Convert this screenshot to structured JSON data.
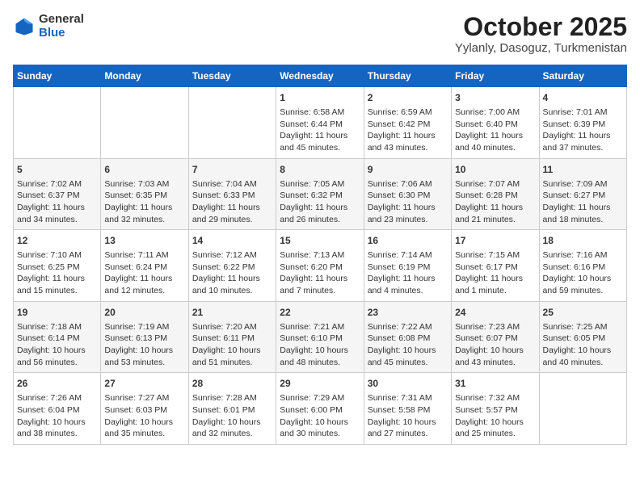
{
  "logo": {
    "general": "General",
    "blue": "Blue"
  },
  "title": "October 2025",
  "subtitle": "Yylanly, Dasoguz, Turkmenistan",
  "headers": [
    "Sunday",
    "Monday",
    "Tuesday",
    "Wednesday",
    "Thursday",
    "Friday",
    "Saturday"
  ],
  "weeks": [
    [
      {
        "day": "",
        "info": ""
      },
      {
        "day": "",
        "info": ""
      },
      {
        "day": "",
        "info": ""
      },
      {
        "day": "1",
        "info": "Sunrise: 6:58 AM\nSunset: 6:44 PM\nDaylight: 11 hours and 45 minutes."
      },
      {
        "day": "2",
        "info": "Sunrise: 6:59 AM\nSunset: 6:42 PM\nDaylight: 11 hours and 43 minutes."
      },
      {
        "day": "3",
        "info": "Sunrise: 7:00 AM\nSunset: 6:40 PM\nDaylight: 11 hours and 40 minutes."
      },
      {
        "day": "4",
        "info": "Sunrise: 7:01 AM\nSunset: 6:39 PM\nDaylight: 11 hours and 37 minutes."
      }
    ],
    [
      {
        "day": "5",
        "info": "Sunrise: 7:02 AM\nSunset: 6:37 PM\nDaylight: 11 hours and 34 minutes."
      },
      {
        "day": "6",
        "info": "Sunrise: 7:03 AM\nSunset: 6:35 PM\nDaylight: 11 hours and 32 minutes."
      },
      {
        "day": "7",
        "info": "Sunrise: 7:04 AM\nSunset: 6:33 PM\nDaylight: 11 hours and 29 minutes."
      },
      {
        "day": "8",
        "info": "Sunrise: 7:05 AM\nSunset: 6:32 PM\nDaylight: 11 hours and 26 minutes."
      },
      {
        "day": "9",
        "info": "Sunrise: 7:06 AM\nSunset: 6:30 PM\nDaylight: 11 hours and 23 minutes."
      },
      {
        "day": "10",
        "info": "Sunrise: 7:07 AM\nSunset: 6:28 PM\nDaylight: 11 hours and 21 minutes."
      },
      {
        "day": "11",
        "info": "Sunrise: 7:09 AM\nSunset: 6:27 PM\nDaylight: 11 hours and 18 minutes."
      }
    ],
    [
      {
        "day": "12",
        "info": "Sunrise: 7:10 AM\nSunset: 6:25 PM\nDaylight: 11 hours and 15 minutes."
      },
      {
        "day": "13",
        "info": "Sunrise: 7:11 AM\nSunset: 6:24 PM\nDaylight: 11 hours and 12 minutes."
      },
      {
        "day": "14",
        "info": "Sunrise: 7:12 AM\nSunset: 6:22 PM\nDaylight: 11 hours and 10 minutes."
      },
      {
        "day": "15",
        "info": "Sunrise: 7:13 AM\nSunset: 6:20 PM\nDaylight: 11 hours and 7 minutes."
      },
      {
        "day": "16",
        "info": "Sunrise: 7:14 AM\nSunset: 6:19 PM\nDaylight: 11 hours and 4 minutes."
      },
      {
        "day": "17",
        "info": "Sunrise: 7:15 AM\nSunset: 6:17 PM\nDaylight: 11 hours and 1 minute."
      },
      {
        "day": "18",
        "info": "Sunrise: 7:16 AM\nSunset: 6:16 PM\nDaylight: 10 hours and 59 minutes."
      }
    ],
    [
      {
        "day": "19",
        "info": "Sunrise: 7:18 AM\nSunset: 6:14 PM\nDaylight: 10 hours and 56 minutes."
      },
      {
        "day": "20",
        "info": "Sunrise: 7:19 AM\nSunset: 6:13 PM\nDaylight: 10 hours and 53 minutes."
      },
      {
        "day": "21",
        "info": "Sunrise: 7:20 AM\nSunset: 6:11 PM\nDaylight: 10 hours and 51 minutes."
      },
      {
        "day": "22",
        "info": "Sunrise: 7:21 AM\nSunset: 6:10 PM\nDaylight: 10 hours and 48 minutes."
      },
      {
        "day": "23",
        "info": "Sunrise: 7:22 AM\nSunset: 6:08 PM\nDaylight: 10 hours and 45 minutes."
      },
      {
        "day": "24",
        "info": "Sunrise: 7:23 AM\nSunset: 6:07 PM\nDaylight: 10 hours and 43 minutes."
      },
      {
        "day": "25",
        "info": "Sunrise: 7:25 AM\nSunset: 6:05 PM\nDaylight: 10 hours and 40 minutes."
      }
    ],
    [
      {
        "day": "26",
        "info": "Sunrise: 7:26 AM\nSunset: 6:04 PM\nDaylight: 10 hours and 38 minutes."
      },
      {
        "day": "27",
        "info": "Sunrise: 7:27 AM\nSunset: 6:03 PM\nDaylight: 10 hours and 35 minutes."
      },
      {
        "day": "28",
        "info": "Sunrise: 7:28 AM\nSunset: 6:01 PM\nDaylight: 10 hours and 32 minutes."
      },
      {
        "day": "29",
        "info": "Sunrise: 7:29 AM\nSunset: 6:00 PM\nDaylight: 10 hours and 30 minutes."
      },
      {
        "day": "30",
        "info": "Sunrise: 7:31 AM\nSunset: 5:58 PM\nDaylight: 10 hours and 27 minutes."
      },
      {
        "day": "31",
        "info": "Sunrise: 7:32 AM\nSunset: 5:57 PM\nDaylight: 10 hours and 25 minutes."
      },
      {
        "day": "",
        "info": ""
      }
    ]
  ]
}
